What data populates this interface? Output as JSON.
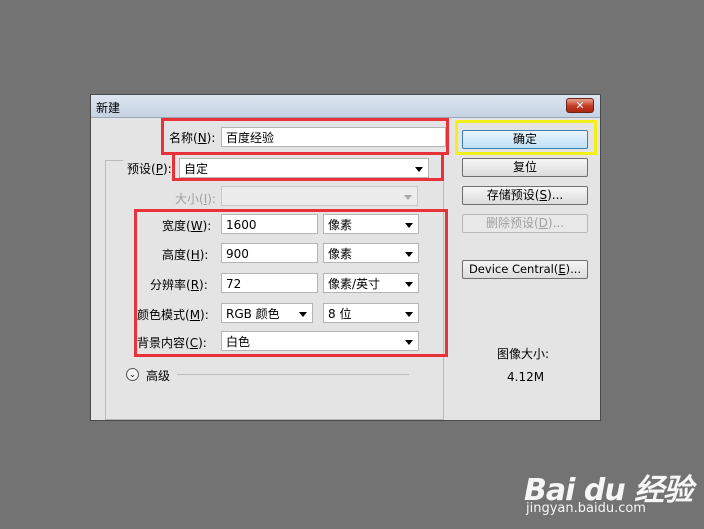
{
  "dialog": {
    "title": "新建",
    "close_label": "✕"
  },
  "form": {
    "name_label": "名称(",
    "name_key": "N",
    "name_suffix": "):",
    "name_value": "百度经验",
    "preset_label": "预设(",
    "preset_key": "P",
    "preset_suffix": "):",
    "preset_value": "自定",
    "size_label": "大小(",
    "size_key": "I",
    "size_suffix": "):",
    "size_value": "",
    "width_label": "宽度(",
    "width_key": "W",
    "width_suffix": "):",
    "width_value": "1600",
    "width_unit": "像素",
    "height_label": "高度(",
    "height_key": "H",
    "height_suffix": "):",
    "height_value": "900",
    "height_unit": "像素",
    "resolution_label": "分辨率(",
    "resolution_key": "R",
    "resolution_suffix": "):",
    "resolution_value": "72",
    "resolution_unit": "像素/英寸",
    "color_mode_label": "颜色模式(",
    "color_mode_key": "M",
    "color_mode_suffix": "):",
    "color_mode_value": "RGB 颜色",
    "bit_depth_value": "8 位",
    "background_label": "背景内容(",
    "background_key": "C",
    "background_suffix": "):",
    "background_value": "白色",
    "advanced_label": "高级"
  },
  "buttons": {
    "ok": "确定",
    "reset": "复位",
    "save_preset_pre": "存储预设(",
    "save_preset_key": "S",
    "save_preset_post": ")...",
    "delete_preset_pre": "删除预设(",
    "delete_preset_key": "D",
    "delete_preset_post": ")...",
    "device_central_pre": "Device Central(",
    "device_central_key": "E",
    "device_central_post": ")..."
  },
  "image_size": {
    "label": "图像大小:",
    "value": "4.12M"
  },
  "watermark": {
    "logo": "Bai du 经验",
    "url": "jingyan.baidu.com"
  },
  "colors": {
    "highlight_red": "#e8323a",
    "highlight_yellow": "#f2ef1b",
    "background": "#737373"
  }
}
